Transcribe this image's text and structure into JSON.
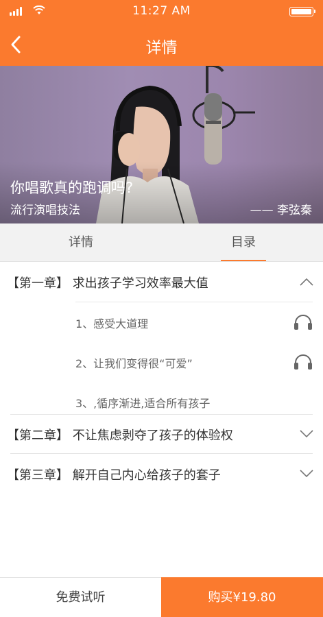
{
  "theme": {
    "accent": "#fb7a2e",
    "text": "#333333",
    "muted": "#666666"
  },
  "status_bar": {
    "time": "11:27 AM",
    "signal_bars": 4,
    "battery_level": 1.0
  },
  "header": {
    "title": "详情",
    "back_icon": "chevron-left-icon"
  },
  "banner": {
    "title": "你唱歌真的跑调吗?",
    "subtitle": "流行演唱技法",
    "author": "—— 李弦秦"
  },
  "tabs": [
    {
      "label": "详情",
      "active": false
    },
    {
      "label": "目录",
      "active": true
    }
  ],
  "chapters": [
    {
      "title": "【第一章】 求出孩子学习效率最大值",
      "expanded": true,
      "lessons": [
        {
          "title": "1、感受大道理",
          "icon": "headphone-icon"
        },
        {
          "title": "2、让我们变得很“可爱”",
          "icon": "headphone-icon"
        },
        {
          "title": "3、,循序渐进,适合所有孩子",
          "icon": ""
        }
      ]
    },
    {
      "title": "【第二章】 不让焦虑剥夺了孩子的体验权",
      "expanded": false,
      "lessons": []
    },
    {
      "title": "【第三章】 解开自己内心给孩子的套子",
      "expanded": false,
      "lessons": []
    }
  ],
  "bottom_bar": {
    "trial_label": "免费试听",
    "buy_label": "购买¥19.80"
  }
}
